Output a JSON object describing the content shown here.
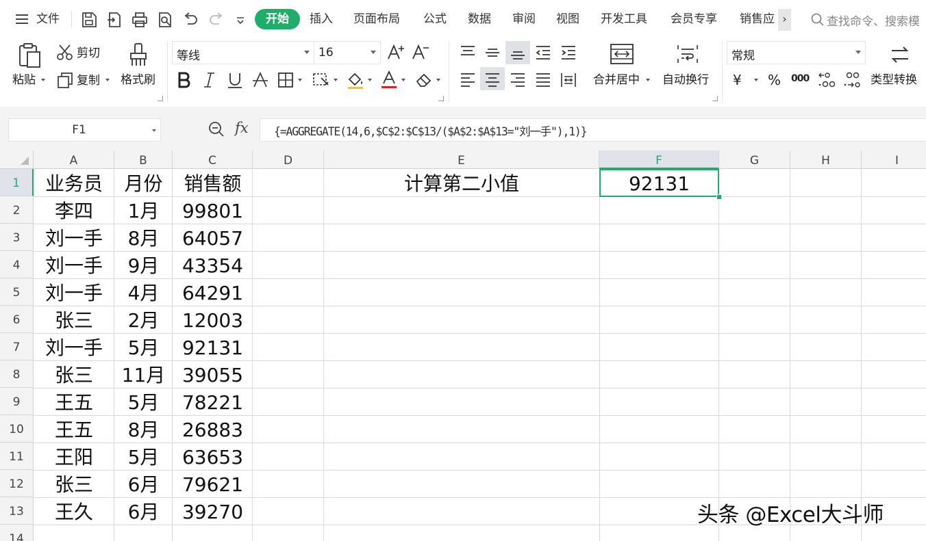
{
  "menubar": {
    "file_label": "文件",
    "tabs": [
      "开始",
      "插入",
      "页面布局",
      "公式",
      "数据",
      "审阅",
      "视图",
      "开发工具",
      "会员专享",
      "销售应"
    ],
    "active_tab": "开始",
    "scroll_more": "›",
    "search_placeholder": "查找命令、搜索模"
  },
  "ribbon": {
    "paste": "粘贴",
    "cut": "剪切",
    "copy": "复制",
    "format_painter": "格式刷",
    "font_name": "等线",
    "font_size": "16",
    "merge_center": "合并居中",
    "wrap_text": "自动换行",
    "number_format": "常规",
    "currency_symbol": "¥",
    "percent_symbol": "%",
    "thousands_symbol": "000",
    "type_convert": "类型转换",
    "font_color": "#e02020",
    "fill_color": "#f2c230"
  },
  "formula_bar": {
    "name_box": "F1",
    "fx_label": "fx",
    "formula": "{=AGGREGATE(14,6,$C$2:$C$13/($A$2:$A$13=\"刘一手\"),1)}"
  },
  "sheet": {
    "columns": [
      "A",
      "B",
      "C",
      "D",
      "E",
      "F",
      "G",
      "H",
      "I"
    ],
    "selected_column": "F",
    "rows": [
      "1",
      "2",
      "3",
      "4",
      "5",
      "6",
      "7",
      "8",
      "9",
      "10",
      "11",
      "12",
      "13",
      "14"
    ],
    "selected_row": "1",
    "headers": {
      "a": "业务员",
      "b": "月份",
      "c": "销售额"
    },
    "label_e1": "计算第二小值",
    "result_f1": "92131",
    "data": [
      {
        "a": "李四",
        "b": "1月",
        "c": "99801"
      },
      {
        "a": "刘一手",
        "b": "8月",
        "c": "64057"
      },
      {
        "a": "刘一手",
        "b": "9月",
        "c": "43354"
      },
      {
        "a": "刘一手",
        "b": "4月",
        "c": "64291"
      },
      {
        "a": "张三",
        "b": "2月",
        "c": "12003"
      },
      {
        "a": "刘一手",
        "b": "5月",
        "c": "92131"
      },
      {
        "a": "张三",
        "b": "11月",
        "c": "39055"
      },
      {
        "a": "王五",
        "b": "5月",
        "c": "78221"
      },
      {
        "a": "王五",
        "b": "8月",
        "c": "26883"
      },
      {
        "a": "王阳",
        "b": "5月",
        "c": "63653"
      },
      {
        "a": "张三",
        "b": "6月",
        "c": "79621"
      },
      {
        "a": "王久",
        "b": "6月",
        "c": "39270"
      }
    ]
  },
  "watermark": "头条 @Excel大斗师",
  "colors": {
    "accent": "#1fae6a",
    "grid_line": "#dadada",
    "header_bg": "#f3f3f3"
  }
}
